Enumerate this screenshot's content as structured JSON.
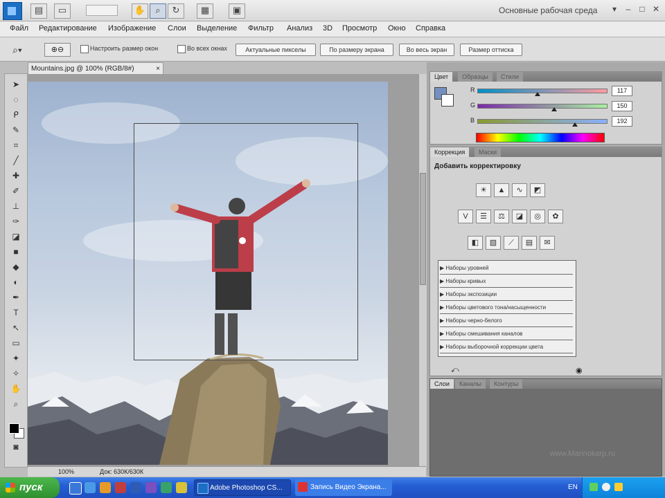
{
  "app": {
    "workspace_label": "Основные рабочая среда"
  },
  "menu": [
    "Файл",
    "Редактирование",
    "Изображение",
    "Слои",
    "Выделение",
    "Фильтр",
    "Анализ",
    "3D",
    "Просмотр",
    "Окно",
    "Справка"
  ],
  "options": {
    "checkbox1_label": "Настроить размер окон",
    "checkbox2_label": "Во всех окнах",
    "buttons": [
      "Актуальные пикселы",
      "По размеру экрана",
      "Во весь экран",
      "Размер оттиска"
    ]
  },
  "document": {
    "tab_title": "Mountains.jpg @ 100% (RGB/8#)",
    "status_zoom": "100%",
    "status_info": "Док: 630К/630К"
  },
  "color_panel": {
    "tabs": [
      "Цвет",
      "Образцы",
      "Стили"
    ],
    "channels": [
      {
        "label": "R",
        "value": "117",
        "fill": 0.46
      },
      {
        "label": "G",
        "value": "150",
        "fill": 0.59
      },
      {
        "label": "B",
        "value": "192",
        "fill": 0.75
      }
    ]
  },
  "corrections_panel": {
    "tabs": [
      "Коррекция",
      "Маски"
    ],
    "header": "Добавить корректировку",
    "presets": [
      "Наборы уровней",
      "Наборы кривых",
      "Наборы экспозиции",
      "Наборы цветового тона/насыщенности",
      "Наборы черно-белого",
      "Наборы смешивания каналов",
      "Наборы выборочной коррекции цвета"
    ]
  },
  "layers_panel": {
    "tabs": [
      "Слои",
      "Каналы",
      "Контуры"
    ]
  },
  "watermark": "www.Marinokarp.ru",
  "taskbar": {
    "start_label": "пуск",
    "tasks": [
      "Adobe Photoshop CS...",
      "Запись Видео Экрана..."
    ],
    "lang": "EN"
  },
  "colors": {
    "accent": "#1c6fc4",
    "taskbar": "#245ed4",
    "start": "#3a9f3a"
  }
}
